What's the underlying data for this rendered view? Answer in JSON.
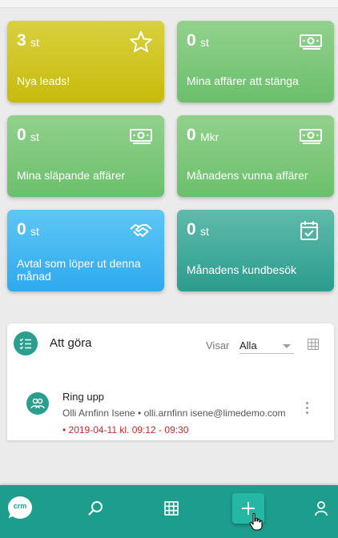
{
  "tiles": [
    {
      "value": "3",
      "unit": "st",
      "label": "Nya leads!",
      "icon": "star-icon"
    },
    {
      "value": "0",
      "unit": "st",
      "label": "Mina affärer att stänga",
      "icon": "money-icon"
    },
    {
      "value": "0",
      "unit": "st",
      "label": "Mina släpande affärer",
      "icon": "money-icon"
    },
    {
      "value": "0",
      "unit": "Mkr",
      "label": "Månadens vunna affärer",
      "icon": "money-icon"
    },
    {
      "value": "0",
      "unit": "st",
      "label": "Avtal som löper ut denna månad",
      "icon": "handshake-icon"
    },
    {
      "value": "0",
      "unit": "st",
      "label": "Månadens kundbesök",
      "icon": "calendar-check-icon"
    }
  ],
  "todo": {
    "title": "Att göra",
    "filter_label": "Visar",
    "filter_value": "Alla",
    "items": [
      {
        "title": "Ring upp",
        "subtitle": "Olli Arnfinn Isene • olli.arnfinn isene@limedemo.com",
        "date": "• 2019-04-11 kl. 09:12 - 09:30"
      }
    ]
  },
  "bottom_nav": {
    "logo_text": "crm",
    "items": [
      "crm-logo",
      "search-icon",
      "grid-icon",
      "add-icon",
      "user-icon"
    ]
  },
  "colors": {
    "tile_yellow": "#c8ba0b",
    "tile_green": "#6bbf6c",
    "tile_blue": "#2ea9ef",
    "tile_teal": "#2b9c8e",
    "bottom_bar": "#1d9e8d",
    "date_red": "#c62828"
  }
}
